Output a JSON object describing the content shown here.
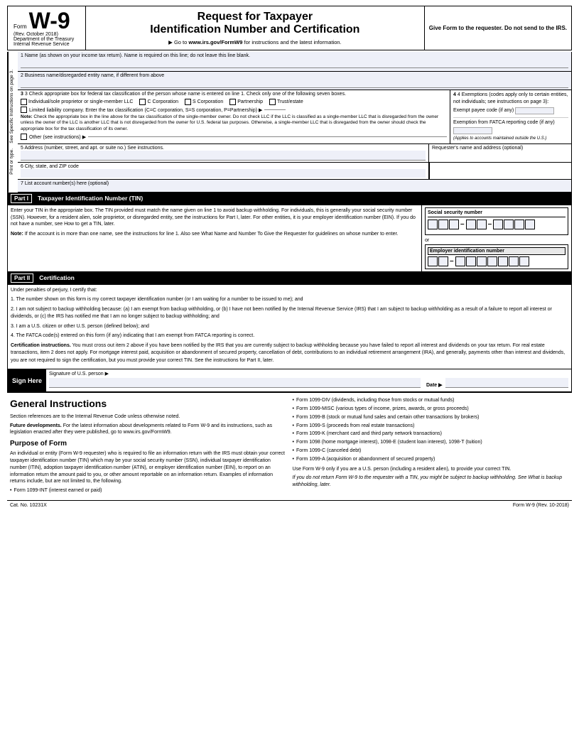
{
  "header": {
    "form_label": "Form",
    "form_number": "W-9",
    "rev_date": "(Rev. October 2018)",
    "dept1": "Department of the Treasury",
    "dept2": "Internal Revenue Service",
    "main_title": "Request for Taxpayer",
    "sub_title": "Identification Number and Certification",
    "url_instruction": "▶ Go to",
    "url": "www.irs.gov/FormW9",
    "url_suffix": "for instructions and the latest information.",
    "give_form": "Give Form to the requester. Do not send to the IRS."
  },
  "form": {
    "row1_label": "1  Name (as shown on your income tax return). Name is required on this line; do not leave this line blank.",
    "row2_label": "2  Business name/disregarded entity name, if different from above",
    "row3_label": "3  Check appropriate box for federal tax classification of the person whose name is entered on line 1. Check only one of the following seven boxes.",
    "row3_exemptions_label": "4  Exemptions (codes apply only to certain entities, not individuals; see instructions on page 3):",
    "individual_label": "Individual/sole proprietor or single-member LLC",
    "c_corp_label": "C Corporation",
    "s_corp_label": "S Corporation",
    "partnership_label": "Partnership",
    "trust_label": "Trust/estate",
    "llc_label": "Limited liability company. Enter the tax classification (C=C corporation, S=S corporation, P=Partnership) ▶",
    "note_label": "Note:",
    "note_text": "Check the appropriate box in the line above for the tax classification of the single-member owner. Do not check LLC if the LLC is classified as a single-member LLC that is disregarded from the owner unless the owner of the LLC is another LLC that is not disregarded from the owner for U.S. federal tax purposes. Otherwise, a single-member LLC that is disregarded from the owner should check the appropriate box for the tax classification of its owner.",
    "other_label": "Other (see instructions) ▶",
    "exempt_payee_label": "Exempt payee code (if any)",
    "fatca_label": "Exemption from FATCA reporting code (if any)",
    "applies_note": "(Applies to accounts maintained outside the U.S.)",
    "row5_label": "5  Address (number, street, and apt. or suite no.) See instructions.",
    "row5_right_label": "Requester's name and address (optional)",
    "row6_label": "6  City, state, and ZIP code",
    "row7_label": "7  List account number(s) here (optional)",
    "sidebar_print": "Print or type.",
    "sidebar_see": "See Specific Instructions on page 3.",
    "part1_number": "Part I",
    "part1_title": "Taxpayer Identification Number (TIN)",
    "part1_text": "Enter your TIN in the appropriate box. The TIN provided must match the name given on line 1 to avoid backup withholding. For individuals, this is generally your social security number (SSN). However, for a resident alien, sole proprietor, or disregarded entity, see the instructions for Part I, later. For other entities, it is your employer identification number (EIN). If you do not have a number, see How to get a TIN, later.",
    "part1_note_bold": "Note:",
    "part1_note": "If the account is in more than one name, see the instructions for line 1. Also see What Name and Number To Give the Requester for guidelines on whose number to enter.",
    "ssn_label": "Social security number",
    "or_label": "or",
    "ein_label": "Employer identification number",
    "part2_number": "Part II",
    "part2_title": "Certification",
    "part2_under": "Under penalties of perjury, I certify that:",
    "part2_item1": "1. The number shown on this form is my correct taxpayer identification number (or I am waiting for a number to be issued to me); and",
    "part2_item2": "2. I am not subject to backup withholding because: (a) I am exempt from backup withholding, or (b) I have not been notified by the Internal Revenue Service (IRS) that I am subject to backup withholding as a result of a failure to report all interest or dividends, or (c) the IRS has notified me that I am no longer subject to backup withholding; and",
    "part2_item3": "3. I am a U.S. citizen or other U.S. person (defined below); and",
    "part2_item4": "4. The FATCA code(s) entered on this form (if any) indicating that I am exempt from FATCA reporting is correct.",
    "cert_instructions_bold": "Certification instructions.",
    "cert_instructions": "You must cross out item 2 above if you have been notified by the IRS that you are currently subject to backup withholding because you have failed to report all interest and dividends on your tax return. For real estate transactions, item 2 does not apply. For mortgage interest paid, acquisition or abandonment of secured property, cancellation of debt, contributions to an individual retirement arrangement (IRA), and generally, payments other than interest and dividends, you are not required to sign the certification, but you must provide your correct TIN. See the instructions for Part II, later.",
    "sign_here": "Sign Here",
    "sign_label": "Signature of U.S. person ▶",
    "date_label": "Date ▶"
  },
  "general_instructions": {
    "heading": "General Instructions",
    "intro": "Section references are to the Internal Revenue Code unless otherwise noted.",
    "future_bold": "Future developments.",
    "future_text": "For the latest information about developments related to Form W-9 and its instructions, such as legislation enacted after they were published, go to www.irs.gov/FormW9.",
    "purpose_heading": "Purpose of Form",
    "purpose_text": "An individual or entity (Form W-9 requester) who is required to file an information return with the IRS must obtain your correct taxpayer identification number (TIN) which may be your social security number (SSN), individual taxpayer identification number (ITIN), adoption taxpayer identification number (ATIN), or employer identification number (EIN), to report on an information return the amount paid to you, or other amount reportable on an information return. Examples of information returns include, but are not limited to, the following.",
    "bullet1": "Form 1099-INT (interest earned or paid)",
    "bullet2": "Form 1099-DIV (dividends, including those from stocks or mutual funds)",
    "bullet3": "Form 1099-MISC (various types of income, prizes, awards, or gross proceeds)",
    "bullet4": "Form 1099-B (stock or mutual fund sales and certain other transactions by brokers)",
    "bullet5": "Form 1099-S (proceeds from real estate transactions)",
    "bullet6": "Form 1099-K (merchant card and third party network transactions)",
    "bullet7": "Form 1098 (home mortgage interest), 1098-E (student loan interest), 1098-T (tuition)",
    "bullet8": "Form 1099-C (canceled debt)",
    "bullet9": "Form 1099-A (acquisition or abandonment of secured property)",
    "use_w9_text": "Use Form W-9 only if you are a U.S. person (including a resident alien), to provide your correct TIN.",
    "italic_note": "If you do not return Form W-9 to the requester with a TIN, you might be subject to backup withholding. See What is backup withholding, later."
  },
  "footer": {
    "cat_number": "Cat. No. 10231X",
    "form_id": "Form W-9 (Rev. 10-2018)"
  }
}
